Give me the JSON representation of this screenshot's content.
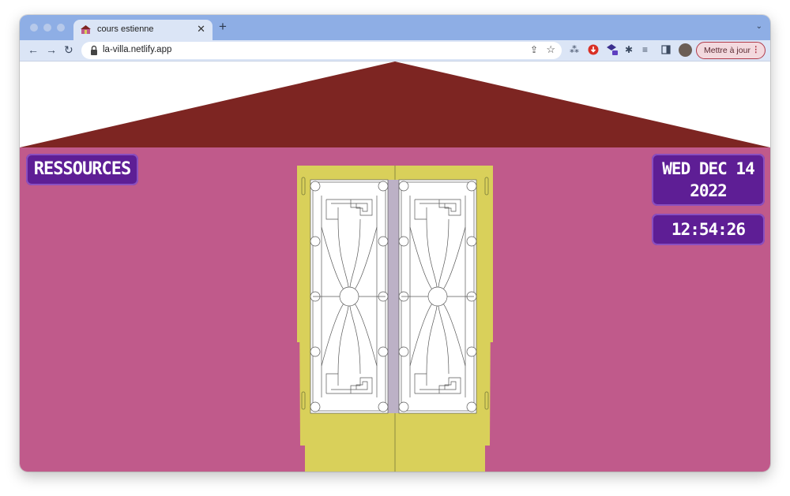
{
  "browser": {
    "tab": {
      "title": "cours estienne"
    },
    "address": {
      "url": "la-villa.netlify.app"
    },
    "update_button": {
      "label": "Mettre à jour"
    }
  },
  "page": {
    "ressources_label": "RESSOURCES",
    "date_line1": "WED DEC 14",
    "date_line2": "2022",
    "time": "12:54:26"
  },
  "colors": {
    "roof": "#7d2522",
    "wall": "#c05a8b",
    "door_frame": "#d9d05a",
    "panel": "#5e1e95"
  },
  "icons": [
    "back-icon",
    "forward-icon",
    "reload-icon",
    "lock-icon",
    "share-icon",
    "star-icon",
    "extensions-icon",
    "side-panel-icon",
    "close-icon",
    "new-tab-icon"
  ]
}
